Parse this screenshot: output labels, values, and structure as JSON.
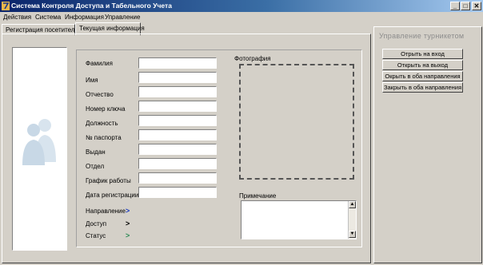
{
  "window": {
    "title": "Система Контроля Доступа и Табельного Учета",
    "minimize": "_",
    "maximize": "□",
    "close": "✕"
  },
  "menu": [
    "Действия",
    "Система",
    "Информация",
    "Управление"
  ],
  "tabs": [
    "Регистрация посетителя",
    "Текущая информация"
  ],
  "form": {
    "fields": [
      {
        "label": "Фамилия",
        "value": ""
      },
      {
        "label": "Имя",
        "value": ""
      },
      {
        "label": "Отчество",
        "value": ""
      },
      {
        "label": "Номер ключа",
        "value": ""
      },
      {
        "label": "Должность",
        "value": ""
      },
      {
        "label": "№ паспорта",
        "value": ""
      },
      {
        "label": "Выдан",
        "value": ""
      },
      {
        "label": "Отдел",
        "value": ""
      },
      {
        "label": "График работы",
        "value": ""
      },
      {
        "label": "Дата регистрации",
        "value": ""
      }
    ],
    "photo_label": "Фотография",
    "note_label": "Примечание",
    "status_rows": [
      {
        "label": "Направление",
        "arrow": ">",
        "arrow_color": "#1f3fbf"
      },
      {
        "label": "Доступ",
        "arrow": ">",
        "arrow_color": "#000000"
      },
      {
        "label": "Статус",
        "arrow": ">",
        "arrow_color": "#2e8b57"
      }
    ]
  },
  "turnstile": {
    "title": "Управление турникетом",
    "buttons": [
      "Отрыть на вход",
      "Открыть на выход",
      "Окрыть в оба направления",
      "Закрыть в оба направления"
    ]
  },
  "icons": {
    "app": "app-logo-icon",
    "placeholder": "user-silhouette-icon"
  },
  "colors": {
    "titlebar_start": "#0a246a",
    "window_bg": "#d4d0c8"
  }
}
